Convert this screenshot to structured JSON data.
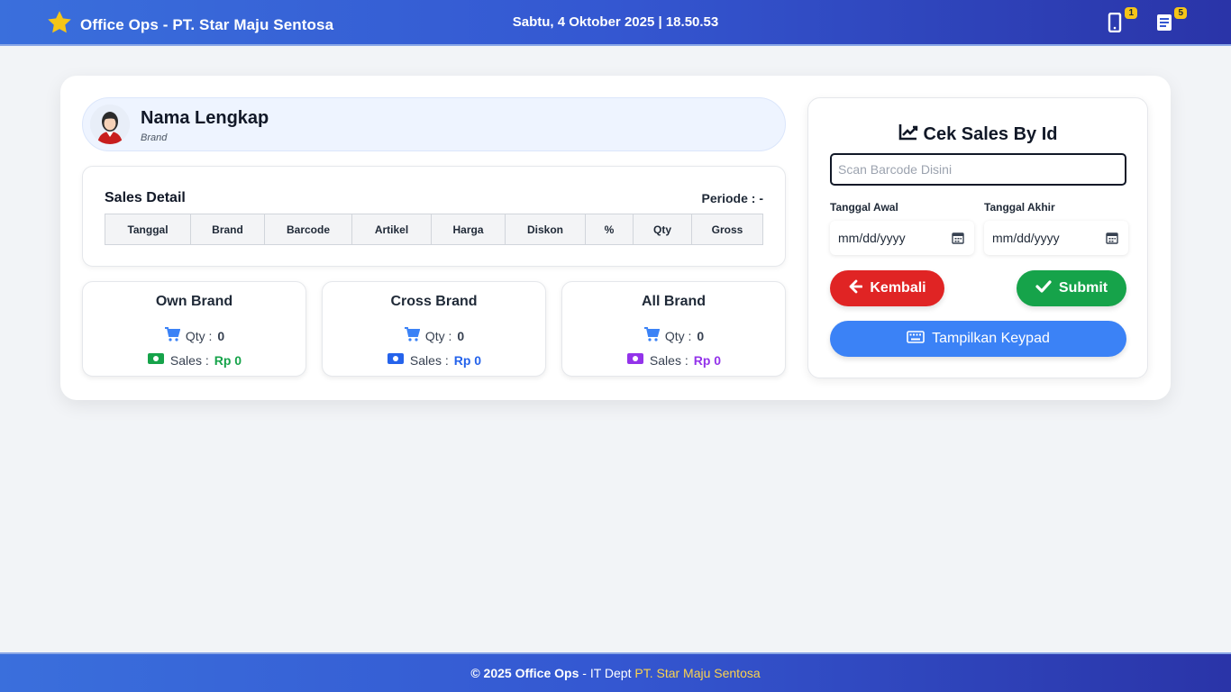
{
  "header": {
    "app_title": "Office Ops - PT. Star Maju Sentosa",
    "datetime": "Sabtu, 4 Oktober 2025 | 18.50.53",
    "phone_badge": "1",
    "notes_badge": "5"
  },
  "profile": {
    "name": "Nama Lengkap",
    "subtitle": "Brand"
  },
  "sales_detail": {
    "title": "Sales Detail",
    "periode": "Periode : -",
    "columns": [
      "Tanggal",
      "Brand",
      "Barcode",
      "Artikel",
      "Harga",
      "Diskon",
      "%",
      "Qty",
      "Gross"
    ]
  },
  "stats": [
    {
      "title": "Own Brand",
      "qty_label": "Qty :",
      "qty": "0",
      "sales_label": "Sales :",
      "sales": "Rp 0",
      "color": "#16a34a"
    },
    {
      "title": "Cross Brand",
      "qty_label": "Qty :",
      "qty": "0",
      "sales_label": "Sales :",
      "sales": "Rp 0",
      "color": "#2563eb"
    },
    {
      "title": "All Brand",
      "qty_label": "Qty :",
      "qty": "0",
      "sales_label": "Sales :",
      "sales": "Rp 0",
      "color": "#9333ea"
    }
  ],
  "cek": {
    "title": "Cek Sales By Id",
    "scan_placeholder": "Scan Barcode Disini",
    "start_label": "Tanggal Awal",
    "end_label": "Tanggal Akhir",
    "start_value": "mm/dd/yyyy",
    "end_value": "mm/dd/yyyy",
    "back_label": "Kembali",
    "submit_label": "Submit",
    "keypad_label": "Tampilkan Keypad"
  },
  "footer": {
    "copyright": "© 2025 Office Ops",
    "dept": " - IT Dept ",
    "company": "PT. Star Maju Sentosa"
  },
  "colors": {
    "primary": "#3457d1",
    "danger": "#e02424",
    "success": "#16a34a",
    "accent": "#3b82f6",
    "star": "#f5c518"
  }
}
